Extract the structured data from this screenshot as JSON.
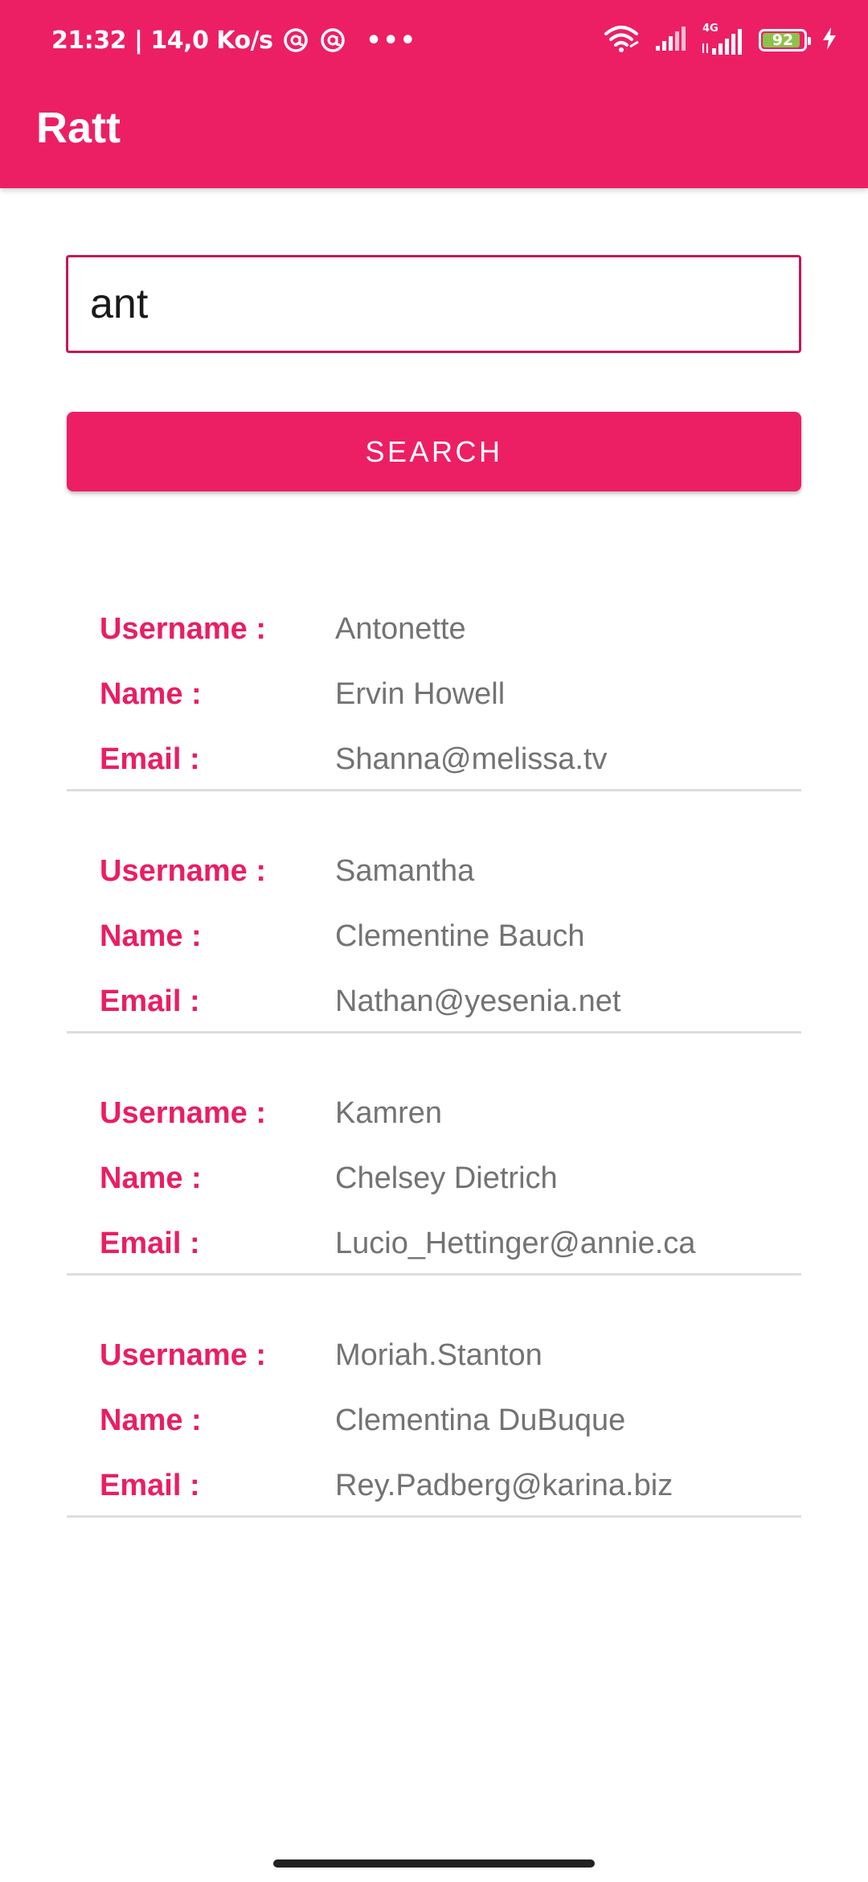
{
  "status_bar": {
    "time_speed": "21:32 | 14,0 Ko/s",
    "network_type": "4G",
    "battery_level": "92",
    "icons": [
      "at-sign-icon",
      "at-sign-icon",
      "more-dots-icon",
      "wifi-icon",
      "signal-icon",
      "signal-4g-icon",
      "battery-icon",
      "charging-icon"
    ]
  },
  "app_bar": {
    "title": "Ratt"
  },
  "search": {
    "value": "ant",
    "button_label": "SEARCH"
  },
  "labels": {
    "username": "Username :",
    "name": "Name :",
    "email": "Email :"
  },
  "users": [
    {
      "username": "Antonette",
      "name": "Ervin Howell",
      "email": "Shanna@melissa.tv"
    },
    {
      "username": "Samantha",
      "name": "Clementine Bauch",
      "email": "Nathan@yesenia.net"
    },
    {
      "username": "Kamren",
      "name": "Chelsey Dietrich",
      "email": "Lucio_Hettinger@annie.ca"
    },
    {
      "username": "Moriah.Stanton",
      "name": "Clementina DuBuque",
      "email": "Rey.Padberg@karina.biz"
    }
  ],
  "colors": {
    "primary": "#ec1f64",
    "label": "#e91e63",
    "value_text": "#737373",
    "divider": "#dddddd",
    "input_border": "#c2185b",
    "battery_fill": "#8bc34a"
  }
}
